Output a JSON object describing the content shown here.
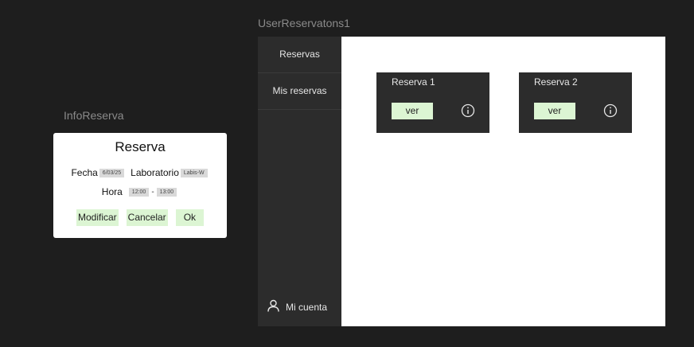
{
  "frames": {
    "info_reserva_label": "InfoReserva",
    "user_reservations_label": "UserReservatons1"
  },
  "info_card": {
    "title": "Reserva",
    "fecha_label": "Fecha",
    "fecha_value": "6/03/25",
    "laboratorio_label": "Laboratorio",
    "laboratorio_value": "Labis-W",
    "hora_label": "Hora",
    "hora_start": "12:00",
    "hora_separator": "-",
    "hora_end": "13:00",
    "buttons": {
      "modificar": "Modificar",
      "cancelar": "Cancelar",
      "ok": "Ok"
    }
  },
  "sidebar": {
    "items": [
      {
        "label": "Reservas"
      },
      {
        "label": "Mis reservas"
      }
    ],
    "account_label": "Mi cuenta"
  },
  "reservations": [
    {
      "title": "Reserva 1",
      "button": "ver"
    },
    {
      "title": "Reserva 2",
      "button": "ver"
    }
  ],
  "colors": {
    "background": "#1e1e1e",
    "panel": "#2c2c2c",
    "accent_green": "#dcf5d3",
    "content_bg": "#ffffff"
  },
  "icons": {
    "account": "user-icon",
    "info": "info-icon"
  }
}
